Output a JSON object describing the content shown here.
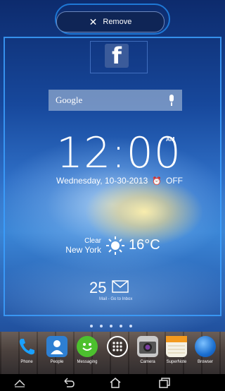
{
  "top_bar": {
    "remove_label": "Remove",
    "close_icon": "close-icon"
  },
  "widgets": {
    "facebook": {
      "letter": "f",
      "brand_color": "#3b5b9a"
    },
    "search": {
      "label": "Google",
      "icon": "microphone-icon"
    },
    "clock": {
      "time": "12:00",
      "ampm": "AM",
      "date": "Wednesday, 10-30-2013",
      "alarm": "OFF"
    },
    "weather": {
      "condition": "Clear",
      "city": "New York",
      "temperature": "16°C",
      "icon": "sun-icon"
    },
    "mail": {
      "count": "25",
      "caption": "Mail - Go to Inbox"
    }
  },
  "page_indicator": {
    "count": 5,
    "active": 2
  },
  "dock": [
    {
      "label": "Phone",
      "icon": "phone-icon"
    },
    {
      "label": "People",
      "icon": "people-icon"
    },
    {
      "label": "Messaging",
      "icon": "messaging-icon"
    },
    {
      "label": "",
      "icon": "apps-icon"
    },
    {
      "label": "Camera",
      "icon": "camera-icon"
    },
    {
      "label": "SuperNote",
      "icon": "supernote-icon"
    },
    {
      "label": "Browser",
      "icon": "browser-icon"
    }
  ],
  "nav": [
    {
      "icon": "up-chevron-icon"
    },
    {
      "icon": "back-icon"
    },
    {
      "icon": "home-icon"
    },
    {
      "icon": "recent-apps-icon"
    }
  ]
}
